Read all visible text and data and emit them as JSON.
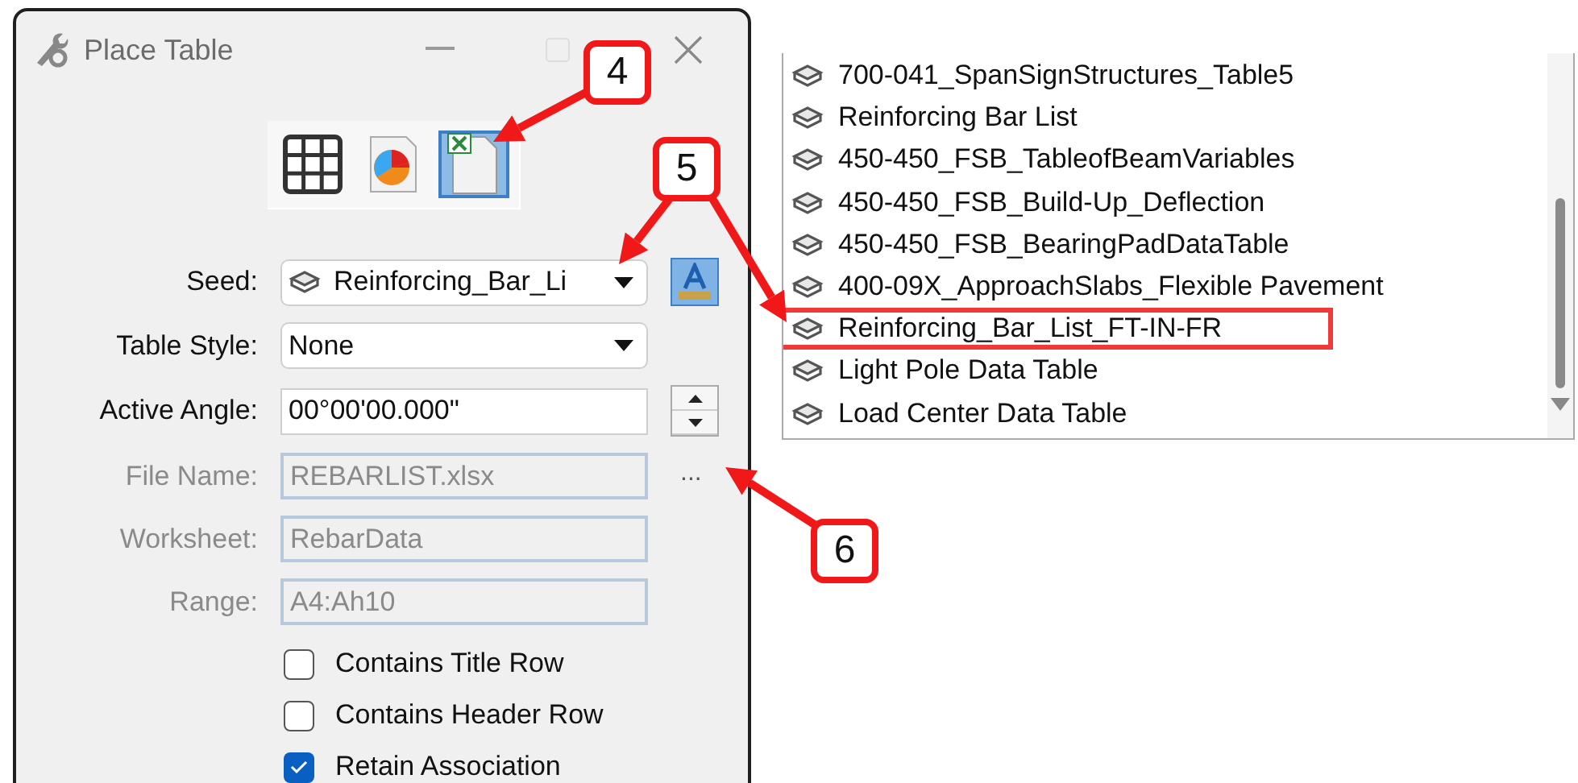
{
  "window": {
    "title": "Place Table"
  },
  "mode_buttons": [
    {
      "kind": "grid",
      "selected": false
    },
    {
      "kind": "chart",
      "selected": false
    },
    {
      "kind": "spreadsheet",
      "selected": true
    }
  ],
  "fields": [
    {
      "kind": "dropdown",
      "label": "Seed:",
      "value": "Reinforcing_Bar_Li",
      "disabled": false
    },
    {
      "kind": "dropdown",
      "label": "Table Style:",
      "value": "None",
      "disabled": false
    },
    {
      "kind": "spinner",
      "label": "Active Angle:",
      "value": "00°00'00.000\"",
      "disabled": false
    },
    {
      "kind": "browse",
      "label": "File Name:",
      "value": "REBARLIST.xlsx",
      "disabled": true,
      "button": "..."
    },
    {
      "kind": "text",
      "label": "Worksheet:",
      "value": "RebarData",
      "disabled": true
    },
    {
      "kind": "text",
      "label": "Range:",
      "value": "A4:Ah10",
      "disabled": true
    }
  ],
  "checkboxes": [
    {
      "label": "Contains Title Row",
      "checked": false
    },
    {
      "label": "Contains Header Row",
      "checked": false
    },
    {
      "label": "Retain Association",
      "checked": true
    }
  ],
  "seed_list": [
    {
      "label": "700-041_SpanSignStructures_Table5",
      "highlighted": false
    },
    {
      "label": "Reinforcing Bar List",
      "highlighted": false
    },
    {
      "label": "450-450_FSB_TableofBeamVariables",
      "highlighted": false
    },
    {
      "label": "450-450_FSB_Build-Up_Deflection",
      "highlighted": false
    },
    {
      "label": "450-450_FSB_BearingPadDataTable",
      "highlighted": false
    },
    {
      "label": "400-09X_ApproachSlabs_Flexible Pavement",
      "highlighted": false
    },
    {
      "label": "Reinforcing_Bar_List_FT-IN-FR",
      "highlighted": true
    },
    {
      "label": "Light Pole Data Table",
      "highlighted": false
    },
    {
      "label": "Load Center Data Table",
      "highlighted": false
    }
  ],
  "callouts": [
    {
      "label": "4"
    },
    {
      "label": "5"
    },
    {
      "label": "6"
    }
  ]
}
